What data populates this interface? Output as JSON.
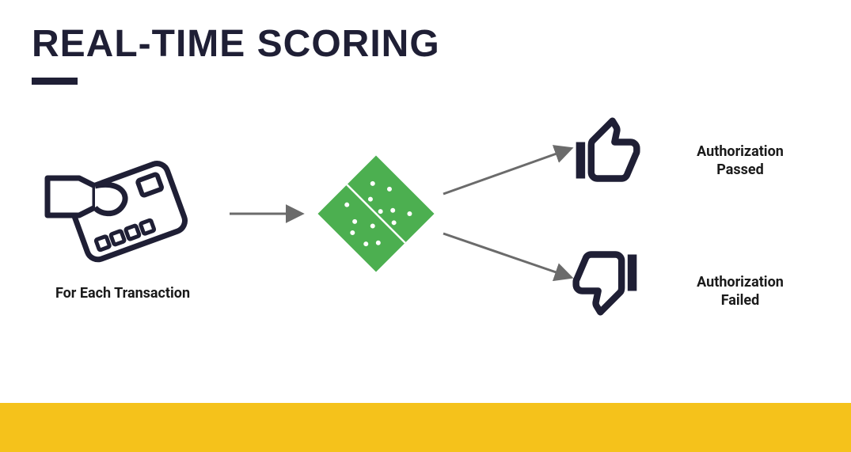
{
  "title": "REAL-TIME SCORING",
  "nodes": {
    "transaction": {
      "label": "For Each Transaction",
      "icon": "hand-card-icon"
    },
    "model": {
      "icon": "ml-model-diamond-icon"
    },
    "passed": {
      "label": "Authorization\nPassed",
      "icon": "thumbs-up-icon"
    },
    "failed": {
      "label": "Authorization\nFailed",
      "icon": "thumbs-down-icon"
    }
  },
  "flow": [
    [
      "transaction",
      "model"
    ],
    [
      "model",
      "passed"
    ],
    [
      "model",
      "failed"
    ]
  ],
  "colors": {
    "ink": "#1f1f35",
    "model": "#4caf50",
    "arrow": "#6b6b6b",
    "accentBar": "#f5c21b"
  }
}
